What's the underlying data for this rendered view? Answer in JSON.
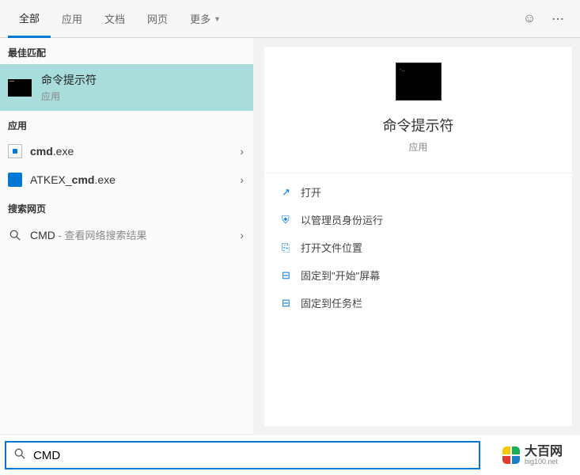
{
  "tabs": {
    "all": "全部",
    "apps": "应用",
    "docs": "文档",
    "web": "网页",
    "more": "更多"
  },
  "sections": {
    "best_match": "最佳匹配",
    "apps": "应用",
    "web": "搜索网页"
  },
  "best_match": {
    "title": "命令提示符",
    "subtitle": "应用"
  },
  "apps_list": [
    {
      "name_html": "<b>cmd</b>.exe",
      "icon": "cmd"
    },
    {
      "name_html": "ATKEX_<b>cmd</b>.exe",
      "icon": "blue"
    }
  ],
  "web_list": [
    {
      "prefix": "CMD",
      "suffix": " - 查看网络搜索结果"
    }
  ],
  "detail": {
    "title": "命令提示符",
    "subtitle": "应用",
    "actions": [
      {
        "icon": "↗",
        "label": "打开"
      },
      {
        "icon": "⛨",
        "label": "以管理员身份运行"
      },
      {
        "icon": "⎘",
        "label": "打开文件位置"
      },
      {
        "icon": "⊟",
        "label": "固定到\"开始\"屏幕"
      },
      {
        "icon": "⊟",
        "label": "固定到任务栏"
      }
    ]
  },
  "search": {
    "value": "CMD"
  },
  "watermark": {
    "main": "大百网",
    "sub": "big100.net"
  }
}
